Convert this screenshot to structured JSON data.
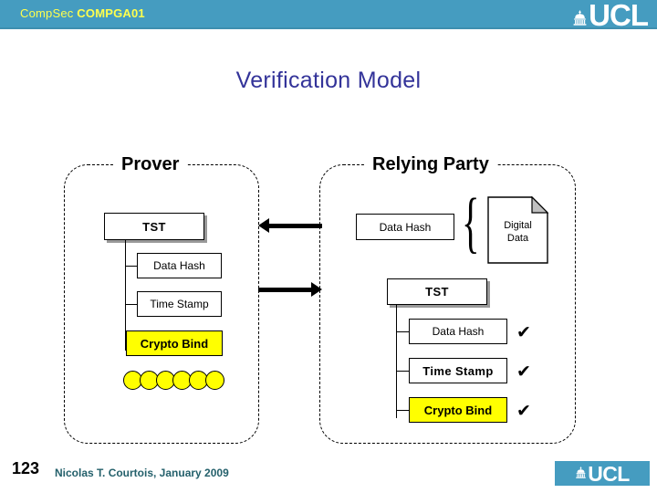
{
  "header": {
    "course_prefix": "CompSec",
    "course_code": "COMPGA01",
    "logo_text": "UCL",
    "bar_color": "#459cc0",
    "course_text_color": "#ffff4d"
  },
  "title": {
    "text": "Verification Model",
    "color": "#333399"
  },
  "diagram": {
    "prover": {
      "label": "Prover",
      "tst_box": "TST",
      "children": [
        {
          "label": "Data Hash",
          "style": "plain"
        },
        {
          "label": "Time Stamp",
          "style": "plain"
        },
        {
          "label": "Crypto Bind",
          "style": "yellow"
        }
      ],
      "bead_count": 6,
      "bead_color": "#ffff00"
    },
    "relying_party": {
      "label": "Relying Party",
      "data_hash_box": "Data Hash",
      "digital_data_line1": "Digital",
      "digital_data_line2": "Data",
      "tst_box": "TST",
      "children": [
        {
          "label": "Data Hash",
          "style": "plain",
          "check": "✔"
        },
        {
          "label": "Time Stamp",
          "style": "bold",
          "check": "✔"
        },
        {
          "label": "Crypto Bind",
          "style": "yellow",
          "check": "✔"
        }
      ]
    },
    "arrow_top_direction": "left",
    "arrow_bottom_direction": "right"
  },
  "footer": {
    "page_number": "123",
    "credit": "Nicolas T. Courtois, January 2009",
    "logo_text": "UCL",
    "credit_color": "#24606b"
  }
}
